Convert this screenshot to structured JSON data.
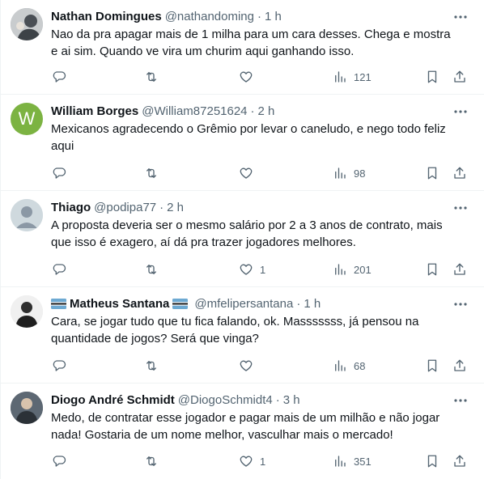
{
  "tweets": [
    {
      "name": "Nathan Domingues",
      "handle": "@nathandoming",
      "separator": "·",
      "time": "1 h",
      "text": "Nao da pra apagar mais de 1 milha para um cara desses. Chega e mostra e ai sim. Quando ve vira um churim aqui ganhando isso.",
      "likes": "",
      "views": "121",
      "avatar": "photo"
    },
    {
      "name": "William Borges",
      "handle": "@William87251624",
      "separator": "·",
      "time": "2 h",
      "text": "Mexicanos agradecendo o Grêmio por levar o caneludo, e nego todo feliz aqui",
      "likes": "",
      "views": "98",
      "avatar": "W"
    },
    {
      "name": "Thiago",
      "handle": "@podipa77",
      "separator": "·",
      "time": "2 h",
      "text": "A proposta deveria ser o mesmo salário por 2 a 3 anos de contrato, mais que isso é exagero, aí dá pra trazer jogadores melhores.",
      "likes": "1",
      "views": "201",
      "avatar": "default"
    },
    {
      "name": "Matheus Santana",
      "handle": "@mfelipersantana",
      "separator": "·",
      "time": "1 h",
      "text": "Cara, se jogar tudo que tu fica falando, ok. Masssssss, já pensou na quantidade de jogos? Será que vinga?",
      "likes": "",
      "views": "68",
      "avatar": "photo"
    },
    {
      "name": "Diogo André Schmidt",
      "handle": "@DiogoSchmidt4",
      "separator": "·",
      "time": "3 h",
      "text": "Medo, de contratar esse jogador e pagar mais de um milhão e não jogar nada! Gostaria de um nome melhor, vasculhar mais o mercado!",
      "likes": "1",
      "views": "351",
      "avatar": "photo"
    }
  ],
  "colors": {
    "text": "#0f1419",
    "secondary": "#536471",
    "border": "#eff3f4",
    "avatar_w": "#7cb342"
  }
}
